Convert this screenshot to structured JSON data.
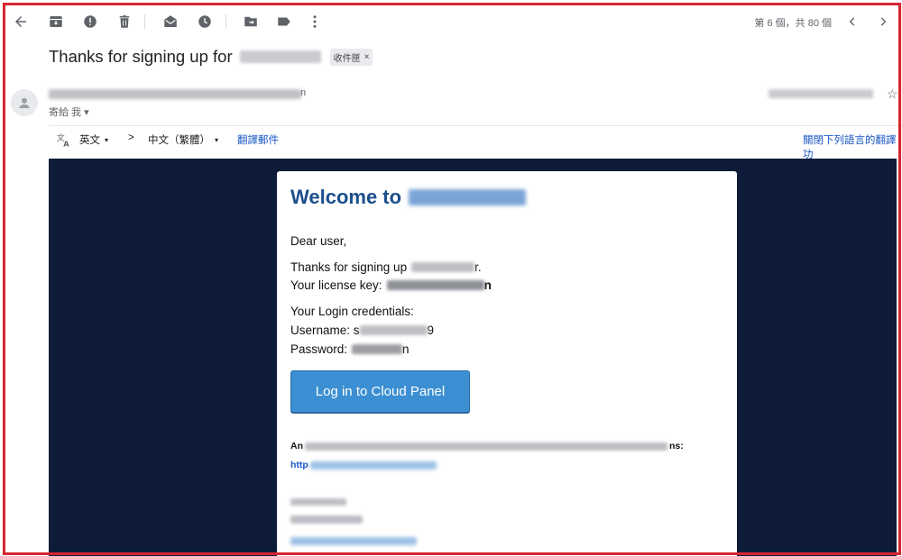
{
  "toolbar": {
    "icons": [
      "back-arrow-icon",
      "archive-icon",
      "report-spam-icon",
      "delete-icon",
      "mark-unread-icon",
      "snooze-icon",
      "move-to-icon",
      "label-icon",
      "more-vert-icon"
    ],
    "pager": "第 6 個，共 80 個"
  },
  "subject": {
    "text": "Thanks for signing up for",
    "label_chip": "收件匣",
    "chip_close": "×"
  },
  "sender": {
    "name_tail": "n",
    "to_me": "寄給 我",
    "to_caret": "▾",
    "star": "☆"
  },
  "translate": {
    "from_lang": "英文",
    "arrow": ">",
    "to_lang": "中文（繁體）",
    "caret": "▾",
    "translate_link": "翻譯郵件",
    "turn_off_link": "關閉下列語言的翻譯功"
  },
  "email": {
    "welcome": "Welcome to",
    "greeting": "Dear user,",
    "thanks_prefix": "Thanks for signing up",
    "thanks_suffix": "r.",
    "license_prefix": "Your license key:",
    "license_suffix": "n",
    "credentials_title": "Your Login credentials:",
    "username_prefix": "Username: s",
    "username_suffix": "9",
    "password_prefix": "Password:",
    "password_suffix": "n",
    "login_button": "Log in to Cloud Panel",
    "footer_prefix": "An",
    "footer_suffix": "ns:",
    "link_prefix": "http"
  },
  "colors": {
    "frame": "#d62631",
    "email_background": "#0e1c3a",
    "welcome_heading": "#1b4f8c",
    "login_button": "#3b8fd2",
    "link": "#1a58c5"
  }
}
